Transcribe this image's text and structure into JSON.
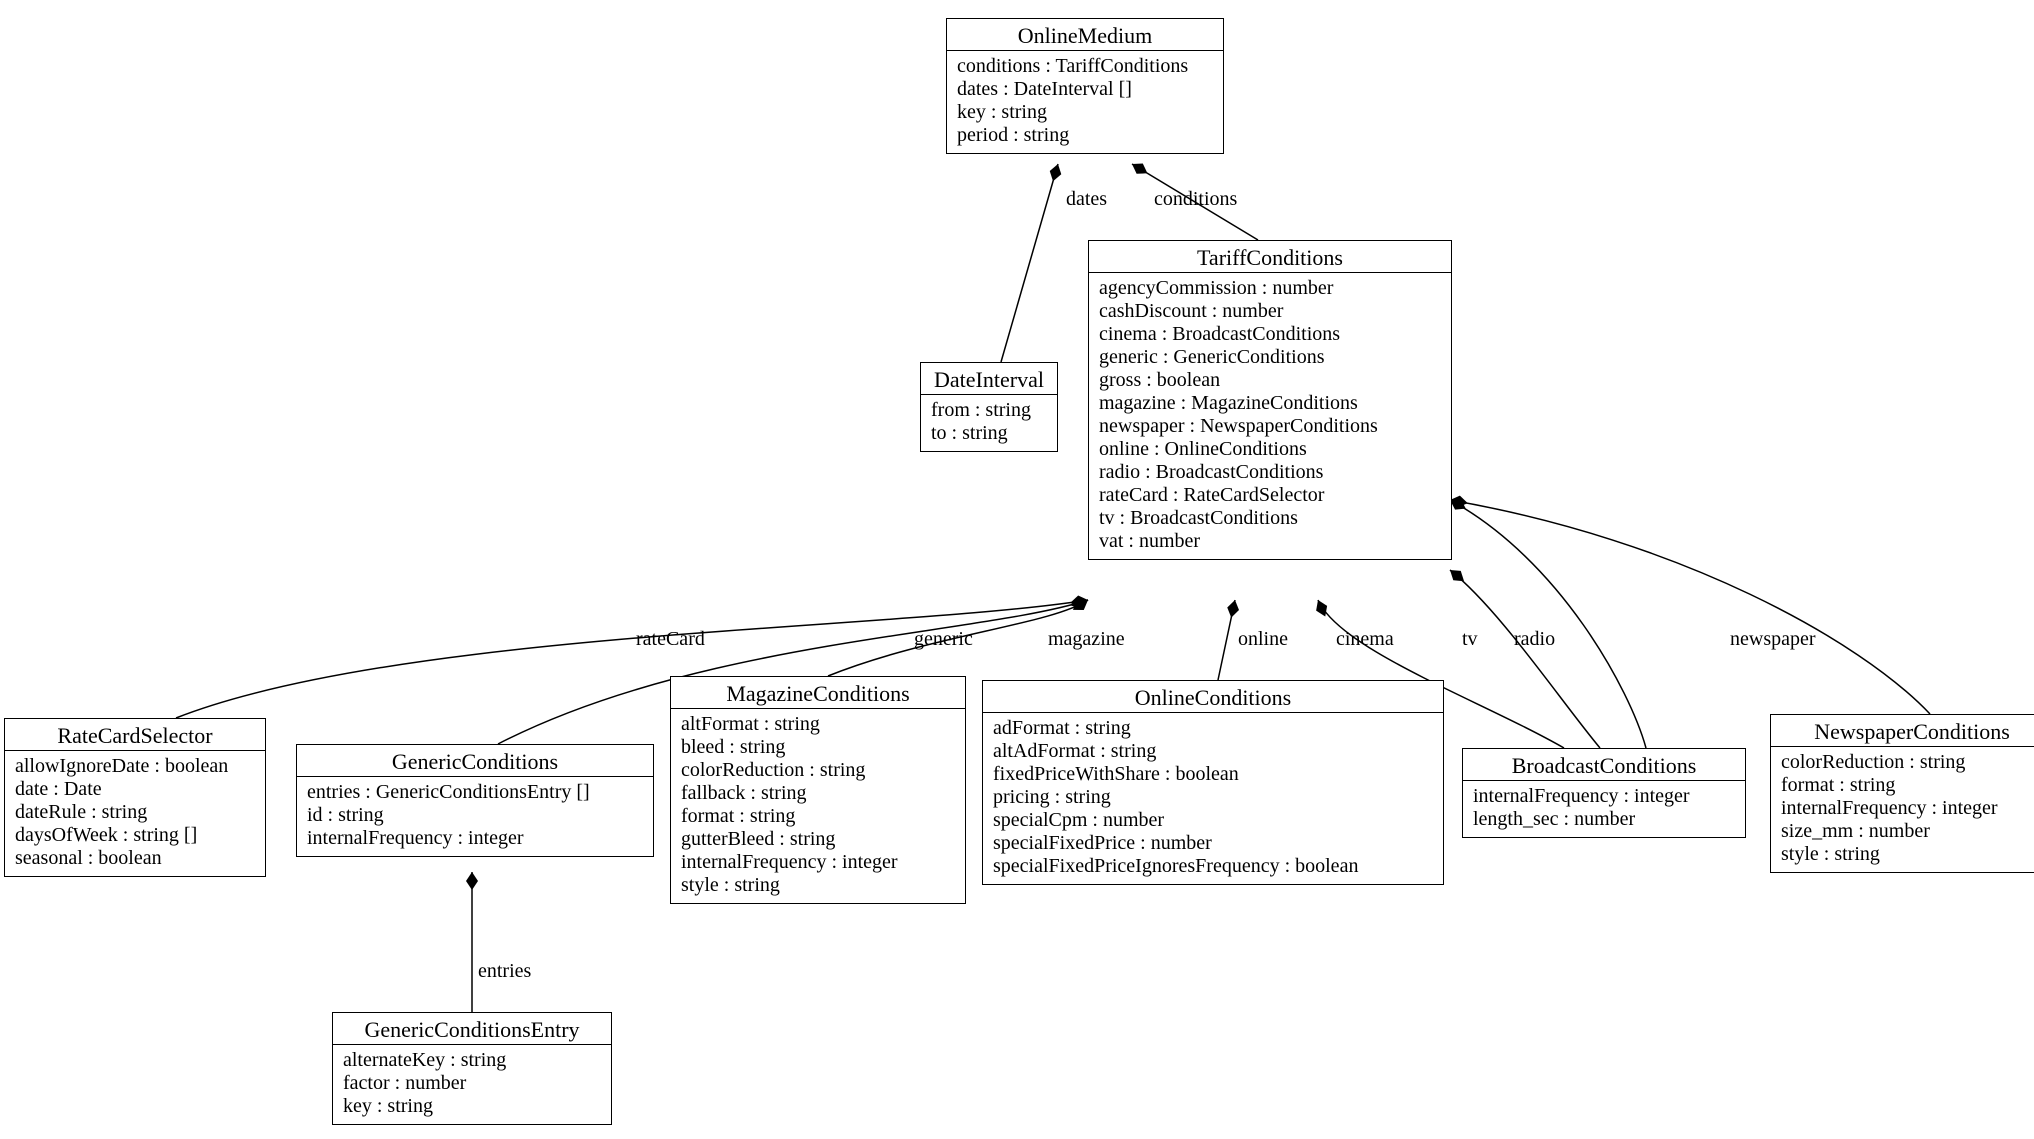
{
  "classes": {
    "OnlineMedium": {
      "title": "OnlineMedium",
      "attrs": [
        "conditions : TariffConditions",
        "dates : DateInterval []",
        "key : string",
        "period : string"
      ]
    },
    "TariffConditions": {
      "title": "TariffConditions",
      "attrs": [
        "agencyCommission : number",
        "cashDiscount : number",
        "cinema : BroadcastConditions",
        "generic : GenericConditions",
        "gross : boolean",
        "magazine : MagazineConditions",
        "newspaper : NewspaperConditions",
        "online : OnlineConditions",
        "radio : BroadcastConditions",
        "rateCard : RateCardSelector",
        "tv : BroadcastConditions",
        "vat : number"
      ]
    },
    "DateInterval": {
      "title": "DateInterval",
      "attrs": [
        "from : string",
        "to : string"
      ]
    },
    "RateCardSelector": {
      "title": "RateCardSelector",
      "attrs": [
        "allowIgnoreDate : boolean",
        "date : Date",
        "dateRule : string",
        "daysOfWeek : string []",
        "seasonal : boolean"
      ]
    },
    "GenericConditions": {
      "title": "GenericConditions",
      "attrs": [
        "entries : GenericConditionsEntry []",
        "id : string",
        "internalFrequency : integer"
      ]
    },
    "GenericConditionsEntry": {
      "title": "GenericConditionsEntry",
      "attrs": [
        "alternateKey : string",
        "factor : number",
        "key : string"
      ]
    },
    "MagazineConditions": {
      "title": "MagazineConditions",
      "attrs": [
        "altFormat : string",
        "bleed : string",
        "colorReduction : string",
        "fallback : string",
        "format : string",
        "gutterBleed : string",
        "internalFrequency : integer",
        "style : string"
      ]
    },
    "OnlineConditions": {
      "title": "OnlineConditions",
      "attrs": [
        "adFormat : string",
        "altAdFormat : string",
        "fixedPriceWithShare : boolean",
        "pricing : string",
        "specialCpm : number",
        "specialFixedPrice : number",
        "specialFixedPriceIgnoresFrequency : boolean"
      ]
    },
    "BroadcastConditions": {
      "title": "BroadcastConditions",
      "attrs": [
        "internalFrequency : integer",
        "length_sec : number"
      ]
    },
    "NewspaperConditions": {
      "title": "NewspaperConditions",
      "attrs": [
        "colorReduction : string",
        "format : string",
        "internalFrequency : integer",
        "size_mm : number",
        "style : string"
      ]
    }
  },
  "edgeLabels": {
    "dates": "dates",
    "conditions": "conditions",
    "rateCard": "rateCard",
    "generic": "generic",
    "magazine": "magazine",
    "online": "online",
    "cinema": "cinema",
    "tv": "tv",
    "radio": "radio",
    "newspaper": "newspaper",
    "entries": "entries"
  }
}
